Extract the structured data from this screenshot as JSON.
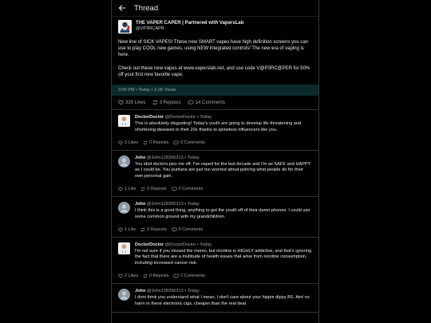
{
  "header": {
    "title": "Thread"
  },
  "post": {
    "author_name": "THE VAPER CAPER | Partnered with VapersLab",
    "author_handle": "@VP3RCAPR",
    "body": "New line of SICK VAPES! These new SMART vapes have high definition screens you can use to play COOL new games, using NEW integrated controls! The new era of vaping is here.\n\nCheck out these new vapes at www.vaperslab.net, and use code V@P3RC@PER for 50% off your first new favorite vape.",
    "meta": "3:00 PM • Today • 3.2K Views",
    "likes": "326 Likes",
    "reposts": "3 Reposts",
    "comments": "14 Comments"
  },
  "replies": [
    {
      "avatar": "doctor",
      "name": "DoctorDoctor",
      "handle_time": "@DoctorDoctor • Today",
      "text": "This is absolutely disgusting! Today's youth are going to develop life threatening and shortening diseases in their 20s thanks to spineless influencers like you.",
      "likes": "3 Likes",
      "reposts": "0 Reposts",
      "comments": "0 Comments"
    },
    {
      "avatar": "john",
      "name": "John",
      "handle_time": "@John128356313 • Today",
      "text": "You idiot doctors piss me off. I've vaped for the last decade and I'm as SAFE and HAPPY as I could be. You puritans are just too worried about policing what people do for their own personal gain.",
      "likes": "1 Like",
      "reposts": "0 Reposts",
      "comments": "0 Comments"
    },
    {
      "avatar": "john",
      "name": "John",
      "handle_time": "@John128356313 • Today",
      "text": "I think this is a good thing, anything to get the youth off of their damn phones. I could use some common ground with my grandchildren.",
      "likes": "1 Like",
      "reposts": "0 Reposts",
      "comments": "0 Comments"
    },
    {
      "avatar": "doctor",
      "name": "DoctorDoctor",
      "handle_time": "@DoctorDoctor • Today",
      "text": "I'm not sure if you missed the memo, but nicotine is HIGHLY addictive, and that's ignoring the fact that there are a multitude of health issues that arise from nicotine consumption, including increased cancer risk.",
      "likes": "2 Likes",
      "reposts": "0 Reposts",
      "comments": "0 Comments"
    },
    {
      "avatar": "john",
      "name": "John",
      "handle_time": "@John128356313 • Today",
      "text": "I dont think you understand what I mean, I don't care about your hippie dippy BS. Aint no harm in these electronic cigs, cheaper than the real deal",
      "likes": "",
      "reposts": "",
      "comments": ""
    }
  ],
  "colors": {
    "background": "#000000",
    "meta_bar": "#0c2a2b",
    "border": "#2f3336",
    "muted": "#9aa3aa"
  },
  "icons": {
    "back": "arrow-left-icon",
    "like": "heart-icon",
    "repost": "repost-icon",
    "comment": "comment-icon"
  }
}
